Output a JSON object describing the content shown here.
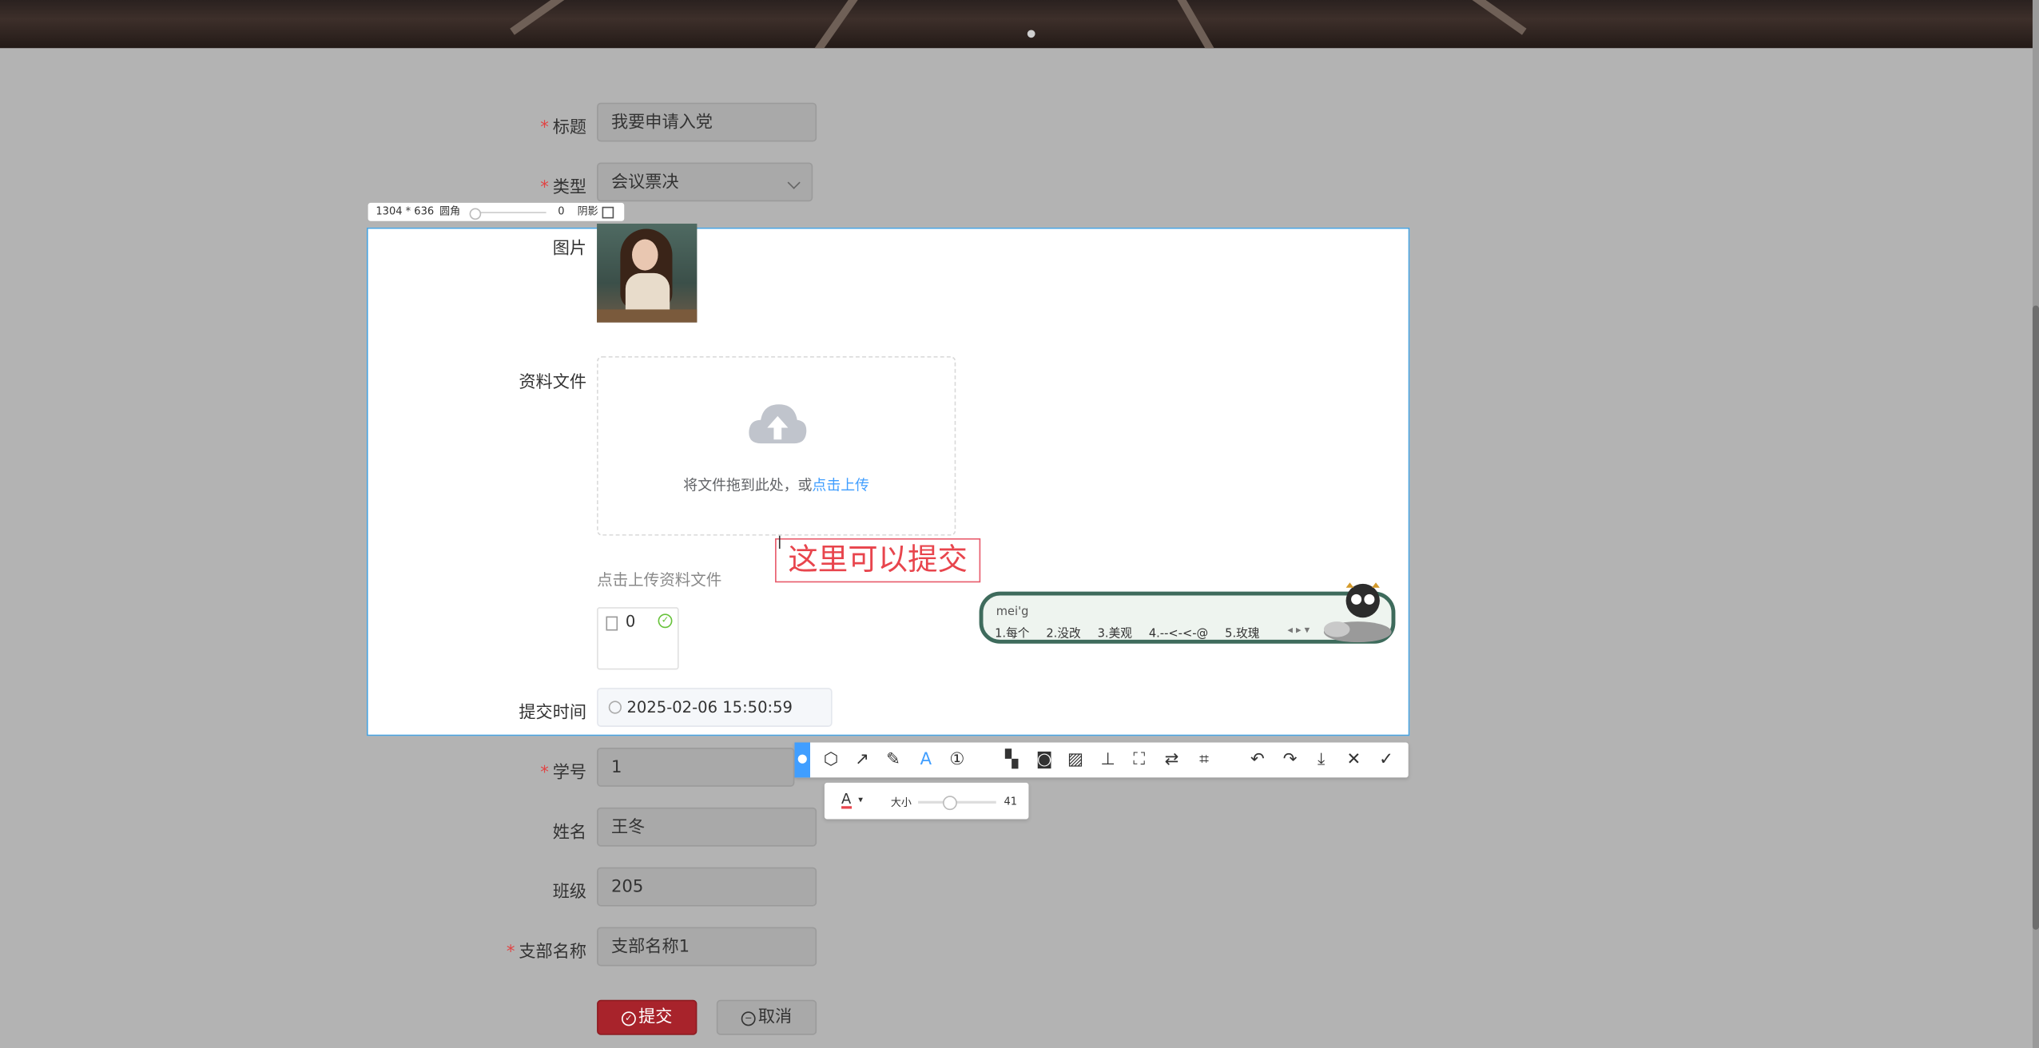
{
  "form": {
    "title_label": "标题",
    "title_value": "我要申请入党",
    "type_label": "类型",
    "type_value": "会议票决",
    "image_label": "图片",
    "file_label": "资料文件",
    "drop_text": "将文件拖到此处，或",
    "drop_link": "点击上传",
    "upload_hint": "点击上传资料文件",
    "file_count": "0",
    "submit_time_label": "提交时间",
    "submit_time_value": "2025-02-06 15:50:59",
    "student_id_label": "学号",
    "student_id_value": "1",
    "name_label": "姓名",
    "name_value": "王冬",
    "class_label": "班级",
    "class_value": "205",
    "branch_label": "支部名称",
    "branch_value": "支部名称1",
    "required_mark": "*",
    "submit_button": "提交",
    "cancel_button": "取消"
  },
  "screenshot_tool": {
    "size_text": "1304 * 636",
    "radius_label": "圆角",
    "radius_value": "0",
    "shadow_label": "阴影",
    "annotation_text": "这里可以提交",
    "font_size_label": "大小",
    "font_size_value": "41",
    "tools": [
      "brush-icon",
      "shape-icon",
      "arrow-icon",
      "pen-icon",
      "text-icon",
      "number-icon",
      "mosaic-icon",
      "blur-icon",
      "hatch-icon",
      "pin-icon",
      "ocr-icon",
      "translate-icon",
      "scan-icon",
      "undo-icon",
      "redo-icon",
      "download-icon",
      "close-icon",
      "check-icon"
    ],
    "accent_color": "#409eff",
    "text_color": "#e8454d"
  },
  "ime": {
    "composition": "mei'g",
    "candidates": [
      "1.每个",
      "2.没改",
      "3.美观",
      "4.--<-<-@",
      "5.玫瑰"
    ]
  },
  "colors": {
    "submit": "#a8232b",
    "link": "#409eff",
    "required": "#e14444"
  }
}
